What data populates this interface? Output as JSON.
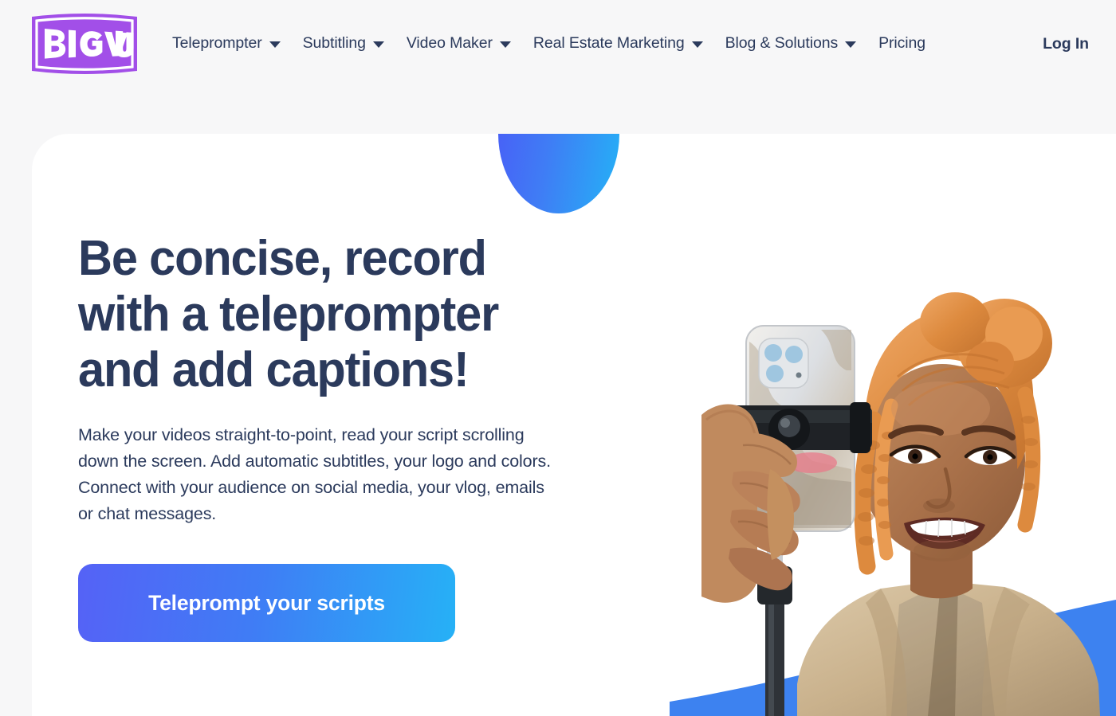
{
  "brand": {
    "logo_text": "BIGVU",
    "logo_color": "#a24fe8",
    "logo_name": "bigvu-logo"
  },
  "header": {
    "nav": [
      {
        "label": "Teleprompter",
        "has_dropdown": true
      },
      {
        "label": "Subtitling",
        "has_dropdown": true
      },
      {
        "label": "Video Maker",
        "has_dropdown": true
      },
      {
        "label": "Real Estate Marketing",
        "has_dropdown": true
      },
      {
        "label": "Blog & Solutions",
        "has_dropdown": true
      },
      {
        "label": "Pricing",
        "has_dropdown": false
      }
    ],
    "login_label": "Log In",
    "background": "#f7f7f8",
    "text_color": "#2b3a5c"
  },
  "hero": {
    "title": "Be concise, record with a teleprompter and add captions!",
    "paragraph_1": "Make your videos straight-to-point, read your script scrolling down the screen. Add automatic subtitles, your logo and colors.",
    "paragraph_2": "Connect with your audience on social media, your vlog, emails or chat messages.",
    "cta_label": "Teleprompt your scripts",
    "cta_gradient_from": "#5562f6",
    "cta_gradient_to": "#26b1f6",
    "title_color": "#2b3a5c"
  },
  "decor": {
    "circle_gradient_from": "#4a5bf6",
    "circle_gradient_to": "#24b2f6",
    "wave_color": "#3d82f0"
  },
  "photo": {
    "alt": "Smiling woman with orange braided hair holding a smartphone on a selfie stick",
    "skin": "#b0754c",
    "hair": "#e08a45",
    "blazer": "#cbb391"
  }
}
